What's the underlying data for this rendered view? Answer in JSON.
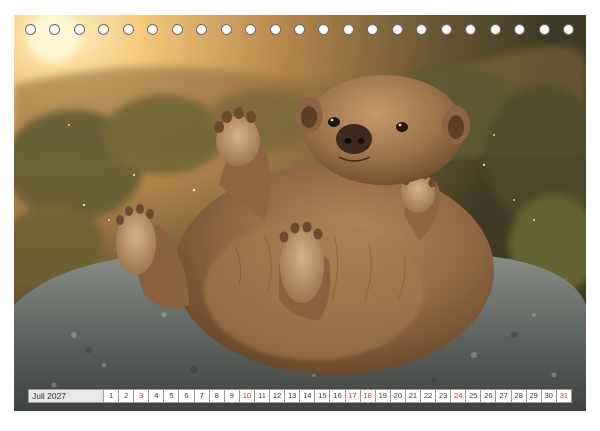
{
  "calendar": {
    "month_label": "Juli 2027",
    "days": [
      {
        "n": "1",
        "sunday": false
      },
      {
        "n": "2",
        "sunday": false
      },
      {
        "n": "3",
        "sunday": true
      },
      {
        "n": "4",
        "sunday": false
      },
      {
        "n": "5",
        "sunday": false
      },
      {
        "n": "6",
        "sunday": false
      },
      {
        "n": "7",
        "sunday": false
      },
      {
        "n": "8",
        "sunday": false
      },
      {
        "n": "9",
        "sunday": false
      },
      {
        "n": "10",
        "sunday": true
      },
      {
        "n": "11",
        "sunday": false
      },
      {
        "n": "12",
        "sunday": false
      },
      {
        "n": "13",
        "sunday": false
      },
      {
        "n": "14",
        "sunday": false
      },
      {
        "n": "15",
        "sunday": false
      },
      {
        "n": "16",
        "sunday": false
      },
      {
        "n": "17",
        "sunday": true
      },
      {
        "n": "18",
        "sunday": true
      },
      {
        "n": "19",
        "sunday": false
      },
      {
        "n": "20",
        "sunday": false
      },
      {
        "n": "21",
        "sunday": false
      },
      {
        "n": "22",
        "sunday": false
      },
      {
        "n": "23",
        "sunday": false
      },
      {
        "n": "24",
        "sunday": true
      },
      {
        "n": "25",
        "sunday": false
      },
      {
        "n": "26",
        "sunday": false
      },
      {
        "n": "27",
        "sunday": false
      },
      {
        "n": "28",
        "sunday": false
      },
      {
        "n": "29",
        "sunday": false
      },
      {
        "n": "30",
        "sunday": false
      },
      {
        "n": "31",
        "sunday": true
      }
    ]
  },
  "binding_hole_count": 23,
  "colors": {
    "sunday_text": "#c0392b",
    "weekday_text": "#3a3a3a",
    "month_box": "#e9e9e9",
    "border": "#9a9a9a"
  }
}
